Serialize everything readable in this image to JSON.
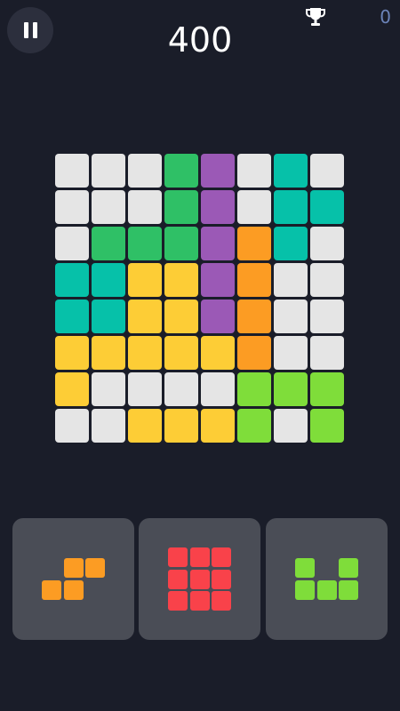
{
  "score": "400",
  "best_score": "0",
  "colors": {
    "empty": "#e5e5e5",
    "green": "#2fc066",
    "purple": "#9b59b6",
    "teal": "#06c1a9",
    "orange": "#fc9c23",
    "yellow": "#fdcd36",
    "lime": "#7fdd3a",
    "red": "#f9424a"
  },
  "board": {
    "rows": [
      [
        "empty",
        "empty",
        "empty",
        "green",
        "purple",
        "empty",
        "teal",
        "empty"
      ],
      [
        "empty",
        "empty",
        "empty",
        "green",
        "purple",
        "empty",
        "teal",
        "teal"
      ],
      [
        "empty",
        "green",
        "green",
        "green",
        "purple",
        "orange",
        "teal",
        "empty"
      ],
      [
        "teal",
        "teal",
        "yellow",
        "yellow",
        "purple",
        "orange",
        "empty",
        "empty"
      ],
      [
        "teal",
        "teal",
        "yellow",
        "yellow",
        "purple",
        "orange",
        "empty",
        "empty"
      ],
      [
        "yellow",
        "yellow",
        "yellow",
        "yellow",
        "yellow",
        "orange",
        "empty",
        "empty"
      ],
      [
        "yellow",
        "empty",
        "empty",
        "empty",
        "empty",
        "lime",
        "lime",
        "lime"
      ],
      [
        "empty",
        "empty",
        "yellow",
        "yellow",
        "yellow",
        "lime",
        "empty",
        "lime"
      ]
    ]
  },
  "pieces": [
    {
      "name": "s-shape",
      "color": "orange",
      "cells": [
        [
          0,
          1
        ],
        [
          0,
          2
        ],
        [
          1,
          0
        ],
        [
          1,
          1
        ]
      ]
    },
    {
      "name": "square-3x3",
      "color": "red",
      "cells": [
        [
          0,
          0
        ],
        [
          0,
          1
        ],
        [
          0,
          2
        ],
        [
          1,
          0
        ],
        [
          1,
          1
        ],
        [
          1,
          2
        ],
        [
          2,
          0
        ],
        [
          2,
          1
        ],
        [
          2,
          2
        ]
      ]
    },
    {
      "name": "u-shape",
      "color": "lime",
      "cells": [
        [
          0,
          0
        ],
        [
          0,
          2
        ],
        [
          1,
          0
        ],
        [
          1,
          1
        ],
        [
          1,
          2
        ]
      ]
    }
  ],
  "icons": {
    "pause": "pause-icon",
    "trophy": "trophy-icon"
  }
}
